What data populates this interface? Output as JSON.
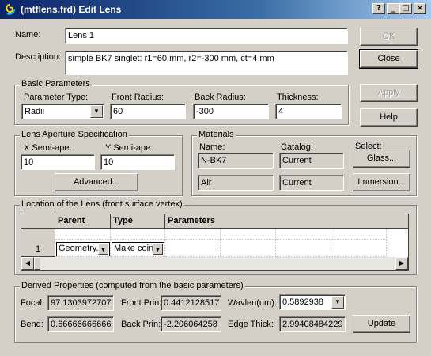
{
  "window": {
    "title": "(mtflens.frd) Edit Lens",
    "controls": [
      "?",
      "_",
      "□",
      "×"
    ]
  },
  "name": {
    "label": "Name:",
    "value": "Lens 1"
  },
  "description": {
    "label": "Description:",
    "value": "simple BK7 singlet: r1=60 mm, r2=-300 mm, ct=4 mm"
  },
  "buttons": {
    "ok": "OK",
    "close": "Close",
    "apply": "Apply",
    "help": "Help",
    "advanced": "Advanced...",
    "glass": "Glass...",
    "immersion": "Immersion...",
    "update": "Update"
  },
  "basic": {
    "title": "Basic Parameters",
    "param_type_label": "Parameter Type:",
    "param_type_value": "Radii",
    "front_radius_label": "Front Radius:",
    "front_radius_value": "60",
    "back_radius_label": "Back Radius:",
    "back_radius_value": "-300",
    "thickness_label": "Thickness:",
    "thickness_value": "4"
  },
  "aperture": {
    "title": "Lens Aperture Specification",
    "x_label": "X Semi-ape:",
    "x_value": "10",
    "y_label": "Y Semi-ape:",
    "y_value": "10"
  },
  "materials": {
    "title": "Materials",
    "name_label": "Name:",
    "catalog_label": "Catalog:",
    "select_label": "Select:",
    "glass_name": "N-BK7",
    "glass_catalog": "Current",
    "immersion_name": "Air",
    "immersion_catalog": "Current"
  },
  "location": {
    "title": "Location of the Lens (front surface vertex)",
    "headers": [
      "Parent",
      "Type",
      "Parameters"
    ],
    "row_number": "1",
    "parent_value": "Geometry.",
    "type_value": "Make coin"
  },
  "derived": {
    "title": "Derived Properties (computed from the basic parameters)",
    "focal_label": "Focal:",
    "focal_value": "97.1303972707",
    "front_prin_label": "Front Prin:",
    "front_prin_value": "0.4412128517",
    "wavlen_label": "Wavlen(um):",
    "wavlen_value": "0.5892938",
    "bend_label": "Bend:",
    "bend_value": "0.66666666666",
    "back_prin_label": "Back Prin:",
    "back_prin_value": "-2.206064258",
    "edge_thick_label": "Edge Thick:",
    "edge_thick_value": "2.99408484229"
  },
  "icons": {
    "app": "app-swirl-icon",
    "dropdown": "chevron-down-icon"
  },
  "colors": {
    "titlebar_start": "#0a246a",
    "titlebar_end": "#a6caf0",
    "face": "#d4d0c8"
  }
}
